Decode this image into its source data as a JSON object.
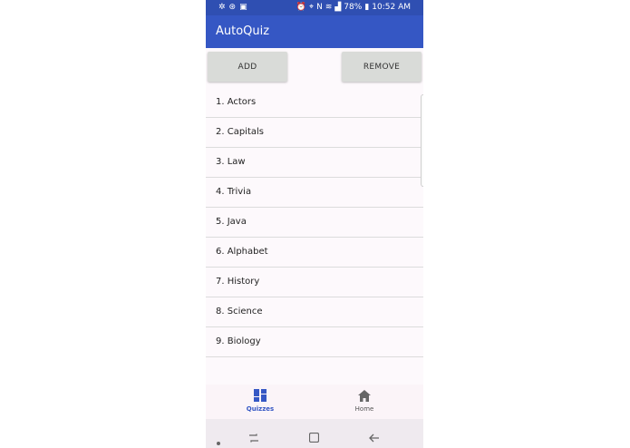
{
  "status_bar": {
    "battery": "78%",
    "time": "10:52 AM"
  },
  "app": {
    "title": "AutoQuiz"
  },
  "actions": {
    "add_label": "ADD",
    "remove_label": "REMOVE"
  },
  "quizzes": [
    "1. Actors",
    "2. Capitals",
    "3. Law",
    "4. Trivia",
    "5. Java",
    "6. Alphabet",
    "7. History",
    "8. Science",
    "9. Biology"
  ],
  "bottom_nav": {
    "items": [
      {
        "label": "Quizzes",
        "icon": "dashboard-icon",
        "selected": true
      },
      {
        "label": "Home",
        "icon": "home-icon",
        "selected": false
      }
    ]
  },
  "colors": {
    "primary": "#3557c4",
    "status_bar": "#2f4fb2",
    "button": "#d9dbd8"
  }
}
